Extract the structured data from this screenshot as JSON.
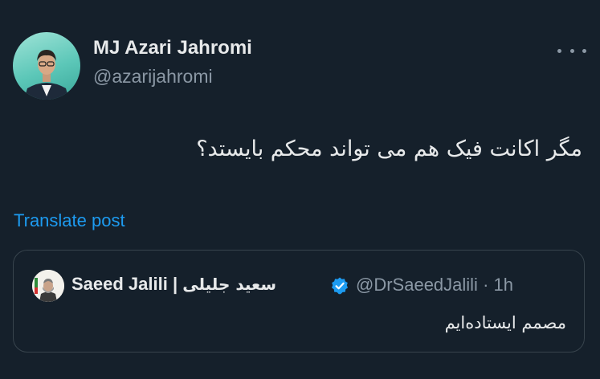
{
  "author": {
    "name": "MJ Azari Jahromi",
    "handle": "@azarijahromi",
    "avatar_icon": "user-avatar-photo"
  },
  "more_icon": "more-horizontal-icon",
  "tweet": {
    "text": "مگر اکانت فیک هم می تواند محکم بایستد؟"
  },
  "translate_label": "Translate post",
  "quoted": {
    "name_latin": "Saeed Jalili | ",
    "name_persian": "سعید جلیلی",
    "handle": "@DrSaeedJalili",
    "separator": "·",
    "time": "1h",
    "text": "مصمم ایستاده‌ایم",
    "verified_icon": "verified-badge-icon",
    "avatar_icon": "user-avatar-photo"
  },
  "colors": {
    "background": "#15202b",
    "text_primary": "#e7e9ea",
    "text_secondary": "#8b98a5",
    "link": "#1d9bf0",
    "border": "#38444d"
  }
}
